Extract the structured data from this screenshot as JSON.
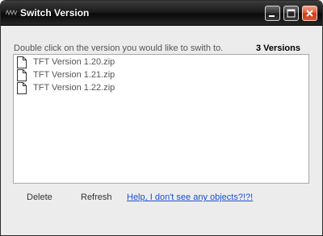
{
  "window": {
    "title": "Switch Version",
    "controls": {
      "minimize": "minimize-icon",
      "maximize": "maximize-icon",
      "close": "close-icon"
    }
  },
  "prompt": "Double click on the version you would like to swith to.",
  "version_count": "3 Versions",
  "versions": [
    {
      "label": "TFT Version 1.20.zip",
      "icon": "file-icon"
    },
    {
      "label": "TFT Version 1.21.zip",
      "icon": "file-icon"
    },
    {
      "label": "TFT Version 1.22.zip",
      "icon": "file-icon"
    }
  ],
  "footer": {
    "delete_label": "Delete",
    "refresh_label": "Refresh",
    "help_label": "Help, I don't see any objects?!?!"
  },
  "colors": {
    "titlebar": "#1c1c1c",
    "close_button": "#d9582f",
    "link": "#1a4fd8",
    "list_background": "#ffffff"
  }
}
